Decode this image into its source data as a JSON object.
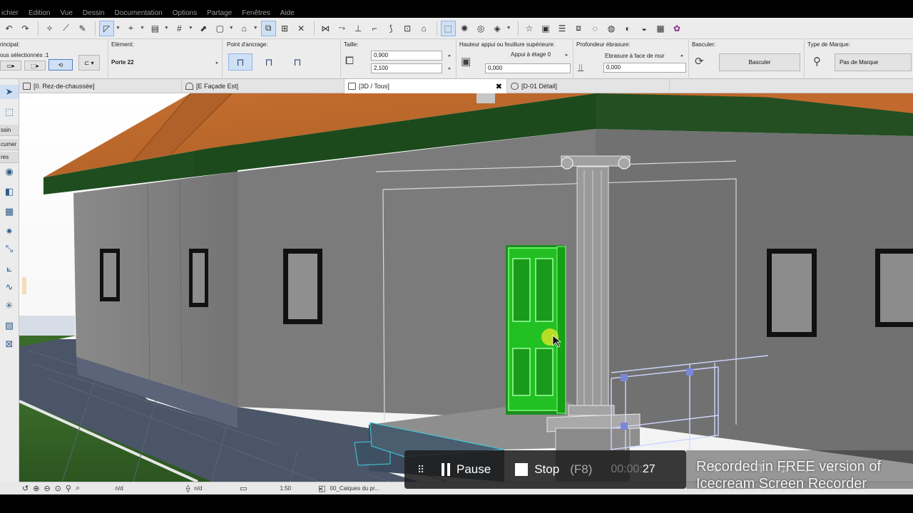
{
  "menu": [
    "ichier",
    "Edition",
    "Vue",
    "Dessin",
    "Documentation",
    "Options",
    "Partage",
    "Fenêtres",
    "Aide"
  ],
  "infobox": {
    "principal_label": "rincipal:",
    "selection_text": "ous sélectionnés :1",
    "element_label": "Elément:",
    "element_value": "Porte 22",
    "anchor_label": "Point d'ancrage:",
    "size_label": "Taille:",
    "width_value": "0,900",
    "height_value": "2,100",
    "sill_label": "Hauteur appui ou feuillure supérieure:",
    "sill_mode": "Appui à étage 0",
    "sill_value": "0,000",
    "reveal_label": "Profondeur ébrasure:",
    "reveal_mode": "Ebrasure à face de mur",
    "reveal_value": "0,000",
    "flip_label": "Basculer:",
    "flip_button": "Basculer",
    "marker_label": "Type de Marque:",
    "marker_value": "Pas de Marque"
  },
  "tabs": [
    {
      "label": "[0. Rez-de-chaussée]"
    },
    {
      "label": "[E Façade Est]"
    },
    {
      "label": "[3D / Tous]"
    },
    {
      "label": "[D-01 Détail]"
    }
  ],
  "toolbox_labels": [
    "ssin",
    "cumer",
    "res"
  ],
  "statusbar": {
    "nd1": "n/d",
    "nd2": "n/d",
    "scale": "1:50",
    "layer": "00_Calques du pr..."
  },
  "recorder": {
    "pause_label": "Pause",
    "stop_label": "Stop",
    "stop_key": "(F8)",
    "time_prefix": "00:00:",
    "time_seconds": "27",
    "watermark": "Recorded in FREE version of Icecream Screen Recorder"
  },
  "colors": {
    "roof": "#b5652c",
    "roof_edge": "#1d4a1d",
    "wall": "#7d7d7d",
    "door": "#1fbf1f",
    "tile": "#3f4a5e",
    "selection_cyan": "#3fd0e0"
  }
}
